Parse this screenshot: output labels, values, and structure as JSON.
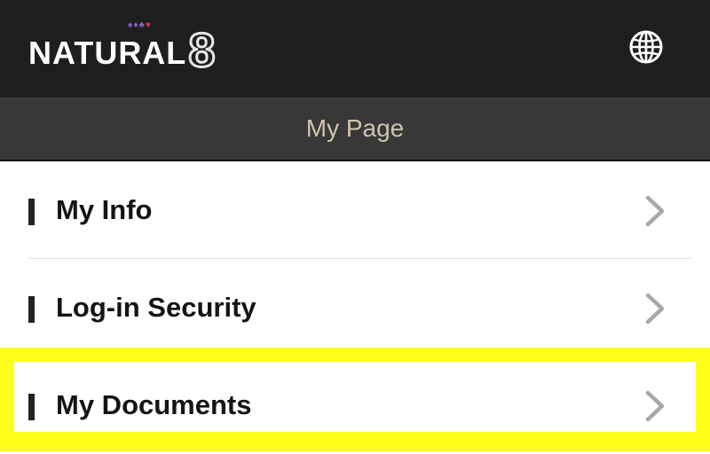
{
  "header": {
    "logo_text": "NATURAL",
    "logo_number": "8",
    "suit_colors": [
      "#8a63c9",
      "#8a63c9",
      "#8a63c9",
      "#d9365f"
    ],
    "language_icon": "globe-icon"
  },
  "subheader": {
    "title": "My Page"
  },
  "menu": {
    "items": [
      {
        "label": "My Info",
        "icon": "chevron-right-icon"
      },
      {
        "label": "Log-in Security",
        "icon": "chevron-right-icon"
      },
      {
        "label": "My Documents",
        "icon": "chevron-right-icon",
        "highlighted": true
      }
    ]
  },
  "colors": {
    "header_bg": "#1e1e1e",
    "subheader_bg": "#383838",
    "subheader_text": "#cfc4ae",
    "highlight": "#ffff1a",
    "chevron": "#a8a8a8"
  }
}
